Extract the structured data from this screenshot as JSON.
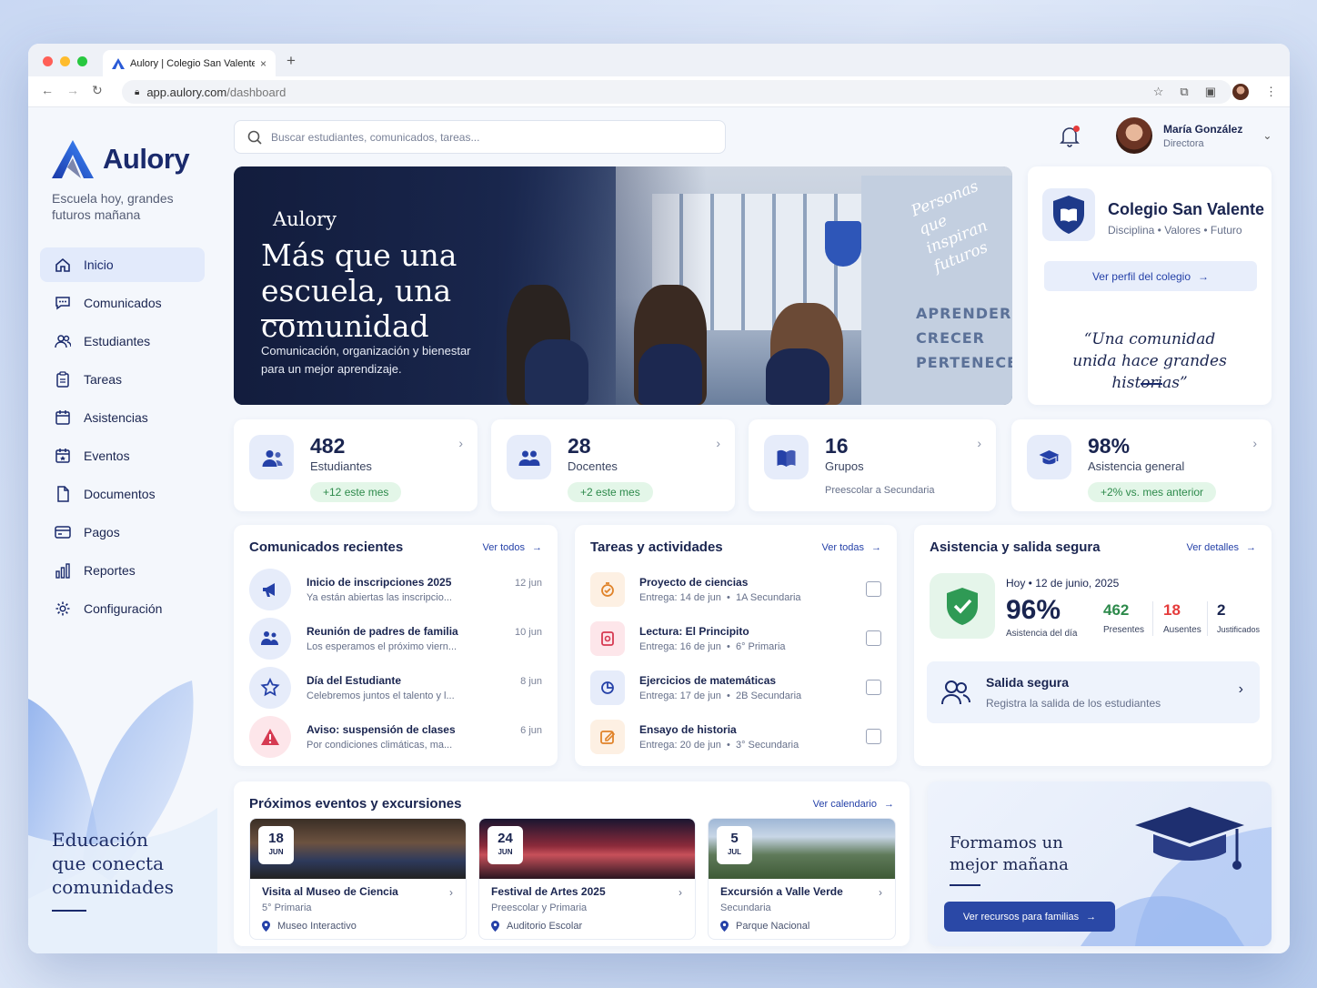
{
  "browser": {
    "tab_title": "Aulory | Colegio San Valente",
    "url_host": "app.aulory.com",
    "url_path": "/dashboard"
  },
  "brand": {
    "name": "Aulory",
    "tagline": "Escuela hoy, grandes futuros mañana",
    "side_text": "Educación que conecta comunidades"
  },
  "menu": [
    {
      "label": "Inicio",
      "icon": "home-icon"
    },
    {
      "label": "Comunicados",
      "icon": "chat-icon"
    },
    {
      "label": "Estudiantes",
      "icon": "users-icon"
    },
    {
      "label": "Tareas",
      "icon": "clipboard-icon"
    },
    {
      "label": "Asistencias",
      "icon": "calendar-icon"
    },
    {
      "label": "Eventos",
      "icon": "calendar-star-icon"
    },
    {
      "label": "Documentos",
      "icon": "document-icon"
    },
    {
      "label": "Pagos",
      "icon": "card-icon"
    },
    {
      "label": "Reportes",
      "icon": "bar-chart-icon"
    },
    {
      "label": "Configuración",
      "icon": "gear-icon"
    }
  ],
  "search": {
    "placeholder": "Buscar estudiantes, comunicados, tareas..."
  },
  "user": {
    "name": "María González",
    "role": "Directora"
  },
  "hero": {
    "brand": "Aulory",
    "title": "Más que una escuela, una comunidad",
    "subtitle": "Comunicación, organización y bienestar para un mejor aprendizaje.",
    "script": "Personas que inspiran futuros",
    "wall": [
      "APRENDER",
      "CRECER",
      "PERTENECER"
    ]
  },
  "school": {
    "name": "Colegio San Valente",
    "motto": "Disciplina • Valores • Futuro",
    "button": "Ver perfil del colegio",
    "quote": "“Una comunidad unida hace grandes historias”"
  },
  "stats": [
    {
      "value": "482",
      "label": "Estudiantes",
      "change": "+12 este mes"
    },
    {
      "value": "28",
      "label": "Docentes",
      "change": "+2 este mes"
    },
    {
      "value": "16",
      "label": "Grupos",
      "sub": "Preescolar a Secundaria"
    },
    {
      "value": "98%",
      "label": "Asistencia general",
      "change": "+2% vs. mes anterior"
    }
  ],
  "comunicados": {
    "title": "Comunicados recientes",
    "link": "Ver todos",
    "items": [
      {
        "title": "Inicio de inscripciones 2025",
        "desc": "Ya están abiertas las inscripcio...",
        "date": "12 jun"
      },
      {
        "title": "Reunión de padres de familia",
        "desc": "Los esperamos el próximo viern...",
        "date": "10 jun"
      },
      {
        "title": "Día del Estudiante",
        "desc": "Celebremos juntos el talento y l...",
        "date": "8 jun"
      },
      {
        "title": "Aviso: suspensión de clases",
        "desc": "Por condiciones climáticas, ma...",
        "date": "6 jun"
      }
    ]
  },
  "tareas": {
    "title": "Tareas y actividades",
    "link": "Ver todas",
    "items": [
      {
        "title": "Proyecto de ciencias",
        "due": "Entrega: 14 de jun",
        "group": "1A Secundaria"
      },
      {
        "title": "Lectura: El Principito",
        "due": "Entrega: 16 de jun",
        "group": "6° Primaria"
      },
      {
        "title": "Ejercicios de matemáticas",
        "due": "Entrega: 17 de jun",
        "group": "2B Secundaria"
      },
      {
        "title": "Ensayo de historia",
        "due": "Entrega: 20 de jun",
        "group": "3° Secundaria"
      }
    ]
  },
  "asistencia": {
    "title": "Asistencia y salida segura",
    "link": "Ver detalles",
    "date": "Hoy • 12 de junio, 2025",
    "pct": "96%",
    "pct_label": "Asistencia del día",
    "presentes": "462",
    "presentes_label": "Presentes",
    "ausentes": "18",
    "ausentes_label": "Ausentes",
    "justificados": "2",
    "justificados_label": "Justificados",
    "salida_title": "Salida segura",
    "salida_desc": "Registra la salida de los estudiantes"
  },
  "eventos": {
    "title": "Próximos eventos y excursiones",
    "link": "Ver calendario",
    "items": [
      {
        "day": "18",
        "month": "JUN",
        "title": "Visita al Museo de Ciencia",
        "group": "5° Primaria",
        "place": "Museo Interactivo"
      },
      {
        "day": "24",
        "month": "JUN",
        "title": "Festival de Artes 2025",
        "group": "Preescolar y Primaria",
        "place": "Auditorio Escolar"
      },
      {
        "day": "5",
        "month": "JUL",
        "title": "Excursión a Valle Verde",
        "group": "Secundaria",
        "place": "Parque Nacional"
      }
    ]
  },
  "promo": {
    "title": "Formamos un mejor mañana",
    "button": "Ver recursos para familias"
  },
  "colors": {
    "primary": "#1a2a6c",
    "accent": "#2541a8",
    "green": "#2d8a4b",
    "red": "#e53b3b"
  }
}
